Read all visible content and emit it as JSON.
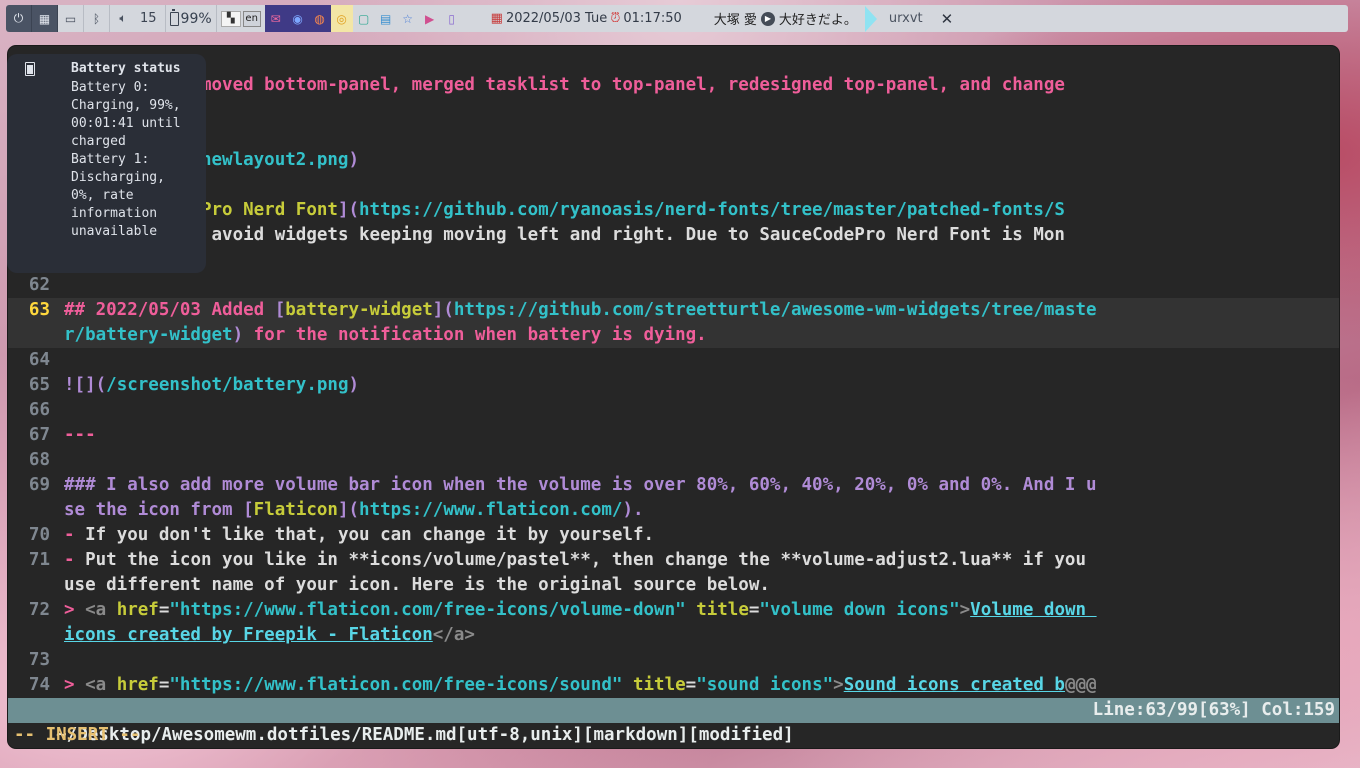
{
  "top_panel": {
    "icons": [
      "power-icon",
      "layout-icon",
      "monitor-icon",
      "bluetooth-icon",
      "volume-icon"
    ],
    "volume_level": "15",
    "battery_percent": "99%",
    "keyboard_layout": "en",
    "datetime": "2022/05/03 Tue",
    "time": "01:17:50",
    "music_artist": "大塚 愛",
    "music_title": "大好きだよ。",
    "task_name": "urxvt",
    "close_symbol": "✕"
  },
  "battery_popup": {
    "title": "Battery status",
    "body": "Battery 0:\nCharging, 99%,\n00:01:41 until\ncharged\nBattery 1:\nDischarging,\n0%, rate\ninformation\nunavailable"
  },
  "editor": {
    "lines": [
      {
        "num": "",
        "segments": [
          {
            "t": "        30 Removed bottom-panel, merged tasklist to top-panel, redesigned top-panel, and change",
            "c": "pink"
          }
        ]
      },
      {
        "num": "",
        "segments": [
          {
            "t": "        .",
            "c": "pink"
          }
        ]
      },
      {
        "num": "",
        "segments": [
          {
            "t": "",
            "c": "white"
          }
        ]
      },
      {
        "num": "",
        "segments": [
          {
            "t": "        shot/newlayout2.png",
            "c": "cyan"
          },
          {
            "t": ")",
            "c": "purple"
          }
        ]
      },
      {
        "num": "",
        "segments": [
          {
            "t": "",
            "c": "white"
          }
        ]
      },
      {
        "num": "",
        "segments": [
          {
            "t": "        eCodePro Nerd Font",
            "c": "yellow"
          },
          {
            "t": "](",
            "c": "purple"
          },
          {
            "t": "https://github.com/ryanoasis/nerd-fonts/tree/master/patched-fonts/S",
            "c": "cyan"
          }
        ]
      },
      {
        "num": "",
        "segments": [
          {
            "t": "        o",
            "c": "cyan"
          },
          {
            "t": ")",
            "c": "purple"
          },
          {
            "t": " to avoid widgets keeping moving left and right. Due to SauceCodePro Nerd Font is Mon",
            "c": "white"
          }
        ]
      },
      {
        "num": "",
        "segments": [
          {
            "t": "        t.",
            "c": "white"
          }
        ]
      },
      {
        "num": "62",
        "segments": [
          {
            "t": "",
            "c": "white"
          }
        ]
      },
      {
        "num": "63",
        "cur": true,
        "segments": [
          {
            "t": "## 2022/05/03 Added ",
            "c": "pink"
          },
          {
            "t": "[",
            "c": "purple"
          },
          {
            "t": "battery-widget",
            "c": "yellow"
          },
          {
            "t": "](",
            "c": "purple"
          },
          {
            "t": "https://github.com/streetturtle/awesome-wm-widgets/tree/maste",
            "c": "cyan"
          }
        ]
      },
      {
        "num": "",
        "cur": true,
        "segments": [
          {
            "t": "r/battery-widget",
            "c": "cyan"
          },
          {
            "t": ")",
            "c": "purple"
          },
          {
            "t": " for the notification when battery is dying.",
            "c": "pink"
          }
        ]
      },
      {
        "num": "64",
        "segments": [
          {
            "t": "",
            "c": "white"
          }
        ]
      },
      {
        "num": "65",
        "segments": [
          {
            "t": "![](",
            "c": "purple"
          },
          {
            "t": "/screenshot/battery.png",
            "c": "cyan"
          },
          {
            "t": ")",
            "c": "purple"
          }
        ]
      },
      {
        "num": "66",
        "segments": [
          {
            "t": "",
            "c": "white"
          }
        ]
      },
      {
        "num": "67",
        "segments": [
          {
            "t": "---",
            "c": "pink"
          }
        ]
      },
      {
        "num": "68",
        "segments": [
          {
            "t": "",
            "c": "white"
          }
        ]
      },
      {
        "num": "69",
        "segments": [
          {
            "t": "### I also add more volume bar icon when the volume is over 80%, 60%, 40%, 20%, 0% and 0%. And I u",
            "c": "purple"
          }
        ]
      },
      {
        "num": "",
        "segments": [
          {
            "t": "se the icon from ",
            "c": "purple"
          },
          {
            "t": "[",
            "c": "purple"
          },
          {
            "t": "Flaticon",
            "c": "yellow"
          },
          {
            "t": "](",
            "c": "purple"
          },
          {
            "t": "https://www.flaticon.com/",
            "c": "cyan"
          },
          {
            "t": ").",
            "c": "purple"
          }
        ]
      },
      {
        "num": "70",
        "segments": [
          {
            "t": "-",
            "c": "pink"
          },
          {
            "t": " If you don't like that, you can change it by yourself.",
            "c": "white"
          }
        ]
      },
      {
        "num": "71",
        "segments": [
          {
            "t": "-",
            "c": "pink"
          },
          {
            "t": " Put the icon you like in **icons/volume/pastel**, then change the **volume-adjust2.lua** if you",
            "c": "white"
          }
        ]
      },
      {
        "num": "",
        "segments": [
          {
            "t": "use different name of your icon. Here is the original source below.",
            "c": "white"
          }
        ]
      },
      {
        "num": "72",
        "segments": [
          {
            "t": "> ",
            "c": "pink"
          },
          {
            "t": "<a ",
            "c": "grey"
          },
          {
            "t": "href",
            "c": "yellow"
          },
          {
            "t": "=",
            "c": "white"
          },
          {
            "t": "\"https://www.flaticon.com/free-icons/volume-down\"",
            "c": "cyan"
          },
          {
            "t": " title",
            "c": "yellow"
          },
          {
            "t": "=",
            "c": "white"
          },
          {
            "t": "\"volume down icons\"",
            "c": "cyan"
          },
          {
            "t": ">",
            "c": "grey"
          },
          {
            "t": "Volume down ",
            "c": "link"
          }
        ]
      },
      {
        "num": "",
        "segments": [
          {
            "t": "icons created by Freepik - Flaticon",
            "c": "link"
          },
          {
            "t": "</a>",
            "c": "grey"
          }
        ]
      },
      {
        "num": "73",
        "segments": [
          {
            "t": "",
            "c": "white"
          }
        ]
      },
      {
        "num": "74",
        "segments": [
          {
            "t": "> ",
            "c": "pink"
          },
          {
            "t": "<a ",
            "c": "grey"
          },
          {
            "t": "href",
            "c": "yellow"
          },
          {
            "t": "=",
            "c": "white"
          },
          {
            "t": "\"https://www.flaticon.com/free-icons/sound\"",
            "c": "cyan"
          },
          {
            "t": " title",
            "c": "yellow"
          },
          {
            "t": "=",
            "c": "white"
          },
          {
            "t": "\"sound icons\"",
            "c": "cyan"
          },
          {
            "t": ">",
            "c": "grey"
          },
          {
            "t": "Sound icons created b",
            "c": "link"
          },
          {
            "t": "@@@",
            "c": "grey"
          }
        ]
      }
    ],
    "status_left": "~/Desktop/Awesomewm.dotfiles/README.md[utf-8,unix][markdown][modified]",
    "status_right": "Line:63/99[63%] Col:159",
    "mode": "-- INSERT --"
  }
}
